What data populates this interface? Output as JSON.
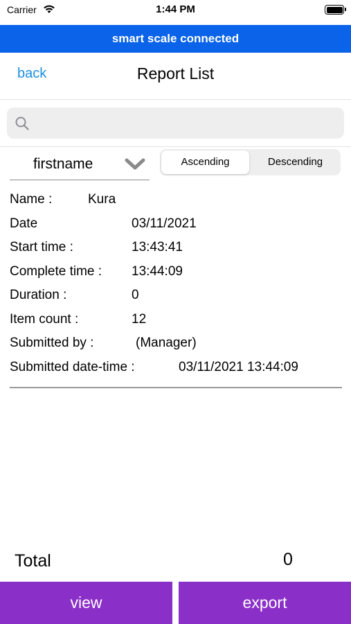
{
  "status_bar": {
    "carrier": "Carrier",
    "time": "1:44 PM"
  },
  "banner": {
    "text": "smart scale connected",
    "color": "#0a63e8"
  },
  "nav": {
    "back_label": "back",
    "title": "Report List"
  },
  "search": {
    "placeholder": "",
    "value": ""
  },
  "sort": {
    "field": "firstname",
    "options": [
      "Ascending",
      "Descending"
    ],
    "selected": "Ascending"
  },
  "report": {
    "name_label": "Name :",
    "name_value": "Kura",
    "date_label": "Date",
    "date_value": "03/11/2021",
    "start_label": "Start time :",
    "start_value": "13:43:41",
    "complete_label": "Complete time :",
    "complete_value": "13:44:09",
    "duration_label": "Duration :",
    "duration_value": "0",
    "item_count_label": "Item count :",
    "item_count_value": "12",
    "submitted_by_label": "Submitted by :",
    "submitted_by_value": "(Manager)",
    "submitted_dt_label": "Submitted date-time :",
    "submitted_dt_value": "03/11/2021 13:44:09"
  },
  "footer": {
    "total_label": "Total",
    "total_value": "0",
    "view_label": "view",
    "export_label": "export",
    "button_color": "#8b2fc9"
  }
}
